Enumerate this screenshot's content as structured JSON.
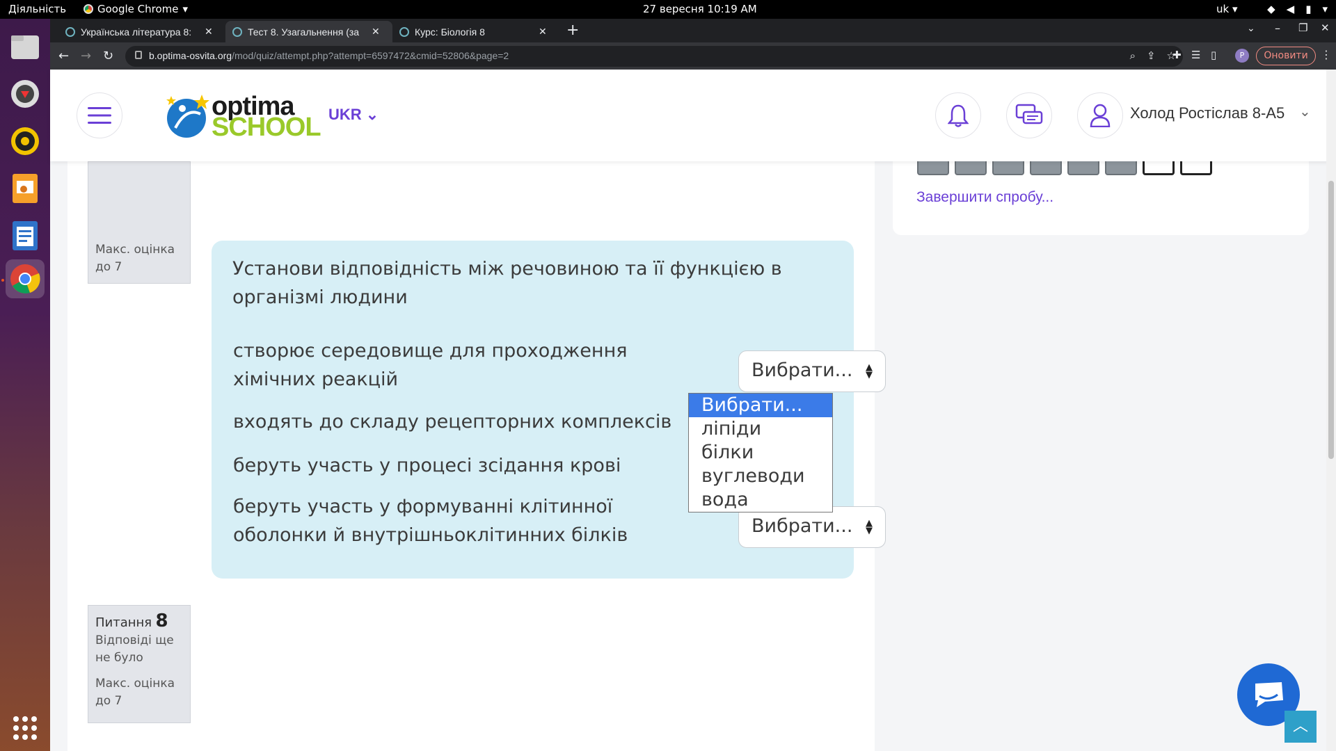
{
  "system": {
    "activities": "Діяльність",
    "app_name": "Google Chrome",
    "clock": "27 вересня  10:19 AM",
    "lang": "uk"
  },
  "tabs": [
    {
      "title": "Українська література 8:",
      "active": false
    },
    {
      "title": "Тест 8. Узагальнення (за",
      "active": true
    },
    {
      "title": "Курс: Біологія 8",
      "active": false
    }
  ],
  "address": {
    "host": "b.optima-osvita.org",
    "path": "/mod/quiz/attempt.php?attempt=6597472&cmid=52806&page=2",
    "profile_initial": "P",
    "update_label": "Оновити"
  },
  "header": {
    "logo_top": "optima",
    "logo_bottom": "SCHOOL",
    "language": "UKR",
    "user_name": "Холод Ростіслав 8-А5"
  },
  "sidebar": {
    "finish_link": "Завершити спробу..."
  },
  "question7_info": {
    "max_grade_line1": "Макс. оцінка",
    "max_grade_line2": "до 7"
  },
  "question": {
    "text": "Установи відповідність між речовиною та її функцією в організмі людини",
    "rows": [
      {
        "text": "створює середовище для проходження хімічних реакцій",
        "selected": "Вибрати..."
      },
      {
        "text": "входять до складу рецепторних комплексів",
        "selected": "Вибрати..."
      },
      {
        "text": "беруть участь у процесі зсідання крові",
        "selected": "Вибрати..."
      },
      {
        "text": "беруть участь у формуванні клітинної оболонки й внутрішньоклітинних білків",
        "selected": "Вибрати..."
      }
    ],
    "dropdown_options": [
      "Вибрати...",
      "ліпіди",
      "білки",
      "вуглеводи",
      "вода"
    ]
  },
  "question8_info": {
    "label": "Питання",
    "number": "8",
    "status_line1": "Відповіді ще",
    "status_line2": "не було",
    "max_grade_line1": "Макс. оцінка",
    "max_grade_line2": "до 7"
  },
  "colors": {
    "accent": "#6a3fd6",
    "card_bg": "#d7eff6",
    "option_selected": "#3b7be8",
    "chat_button": "#1f69d4"
  }
}
